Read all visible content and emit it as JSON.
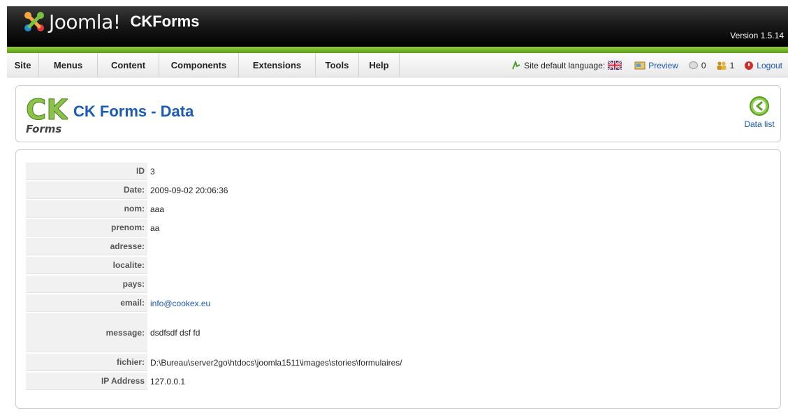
{
  "header": {
    "brand": "Joomla!",
    "app_title": "CKForms",
    "version": "Version 1.5.14"
  },
  "menu": [
    "Site",
    "Menus",
    "Content",
    "Components",
    "Extensions",
    "Tools",
    "Help"
  ],
  "status": {
    "language_label": "Site default language:",
    "preview": "Preview",
    "messages_count": "0",
    "users_count": "1",
    "logout": "Logout"
  },
  "toolbar": {
    "title": "CK Forms - Data",
    "data_list_label": "Data list"
  },
  "details": [
    {
      "label": "ID",
      "value": "3"
    },
    {
      "label": "Date:",
      "value": "2009-09-02 20:06:36"
    },
    {
      "label": "nom:",
      "value": "aaa"
    },
    {
      "label": "prenom:",
      "value": "aa"
    },
    {
      "label": "adresse:",
      "value": ""
    },
    {
      "label": "localite:",
      "value": ""
    },
    {
      "label": "pays:",
      "value": ""
    },
    {
      "label": "email:",
      "value": "info@cookex.eu"
    },
    {
      "label": "message:",
      "value": "dsdfsdf dsf fd"
    },
    {
      "label": "fichier:",
      "value": "D:\\Bureau\\server2go\\htdocs\\joomla1511\\images\\stories\\formulaires/"
    },
    {
      "label": "IP Address",
      "value": "127.0.0.1"
    }
  ],
  "colors": {
    "link": "#1b57b1",
    "title": "#1c5bb5",
    "green_bar": "#6db82a"
  },
  "icons": {
    "joomla": "joomla-logo-icon",
    "language_flag": "uk-flag-icon",
    "preview": "preview-icon",
    "messages": "messages-icon",
    "users": "users-icon",
    "logout": "logout-icon",
    "back": "back-arrow-icon"
  }
}
